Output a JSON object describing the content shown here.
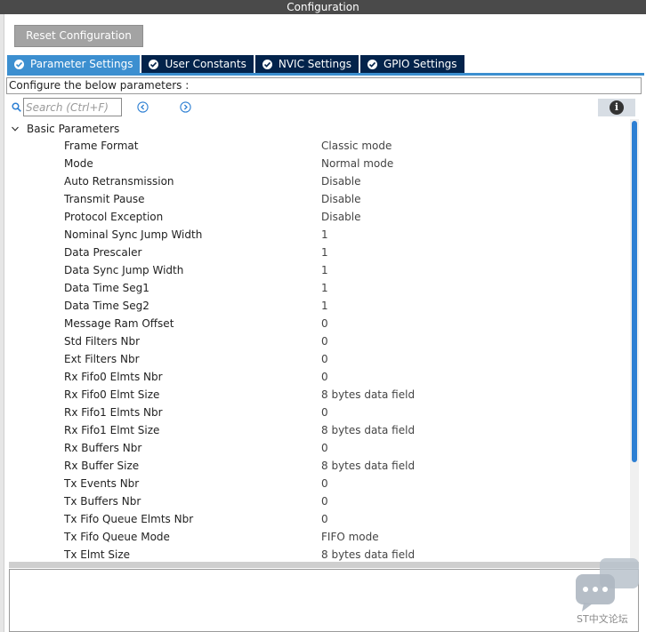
{
  "window": {
    "title": "Configuration"
  },
  "toolbar": {
    "reset_label": "Reset Configuration"
  },
  "tabs": [
    {
      "label": "Parameter Settings",
      "active": true
    },
    {
      "label": "User Constants",
      "active": false
    },
    {
      "label": "NVIC Settings",
      "active": false
    },
    {
      "label": "GPIO Settings",
      "active": false
    }
  ],
  "description": "Configure the below parameters :",
  "search": {
    "placeholder": "Search (Ctrl+F)",
    "value": ""
  },
  "group": {
    "label": "Basic Parameters",
    "expanded": true
  },
  "parameters": [
    {
      "name": "Frame Format",
      "value": "Classic mode"
    },
    {
      "name": "Mode",
      "value": "Normal mode"
    },
    {
      "name": "Auto Retransmission",
      "value": "Disable"
    },
    {
      "name": "Transmit Pause",
      "value": "Disable"
    },
    {
      "name": "Protocol Exception",
      "value": "Disable"
    },
    {
      "name": "Nominal Sync Jump Width",
      "value": "1"
    },
    {
      "name": "Data Prescaler",
      "value": "1"
    },
    {
      "name": "Data Sync Jump Width",
      "value": "1"
    },
    {
      "name": "Data Time Seg1",
      "value": "1"
    },
    {
      "name": "Data Time Seg2",
      "value": "1"
    },
    {
      "name": "Message Ram Offset",
      "value": "0"
    },
    {
      "name": "Std Filters Nbr",
      "value": "0"
    },
    {
      "name": "Ext Filters Nbr",
      "value": "0"
    },
    {
      "name": "Rx Fifo0 Elmts Nbr",
      "value": "0"
    },
    {
      "name": "Rx Fifo0 Elmt Size",
      "value": "8 bytes data field"
    },
    {
      "name": "Rx Fifo1 Elmts Nbr",
      "value": "0"
    },
    {
      "name": "Rx Fifo1 Elmt Size",
      "value": "8 bytes data field"
    },
    {
      "name": "Rx Buffers Nbr",
      "value": "0"
    },
    {
      "name": "Rx Buffer Size",
      "value": "8 bytes data field"
    },
    {
      "name": "Tx Events Nbr",
      "value": "0"
    },
    {
      "name": "Tx Buffers Nbr",
      "value": "0"
    },
    {
      "name": "Tx Fifo Queue Elmts Nbr",
      "value": "0"
    },
    {
      "name": "Tx Fifo Queue Mode",
      "value": "FIFO mode"
    },
    {
      "name": "Tx Elmt Size",
      "value": "8 bytes data field"
    }
  ],
  "watermark": {
    "text": "ST中文论坛"
  },
  "colors": {
    "tab_active": "#3c8fd0",
    "tab_inactive": "#03234b",
    "scroll_thumb": "#2d7fd3",
    "titlebar": "#4a4a4a"
  },
  "icons": [
    "check-icon",
    "search-icon",
    "previous-icon",
    "next-icon",
    "info-icon",
    "chevron-down-icon",
    "chat-bubble-icon"
  ]
}
